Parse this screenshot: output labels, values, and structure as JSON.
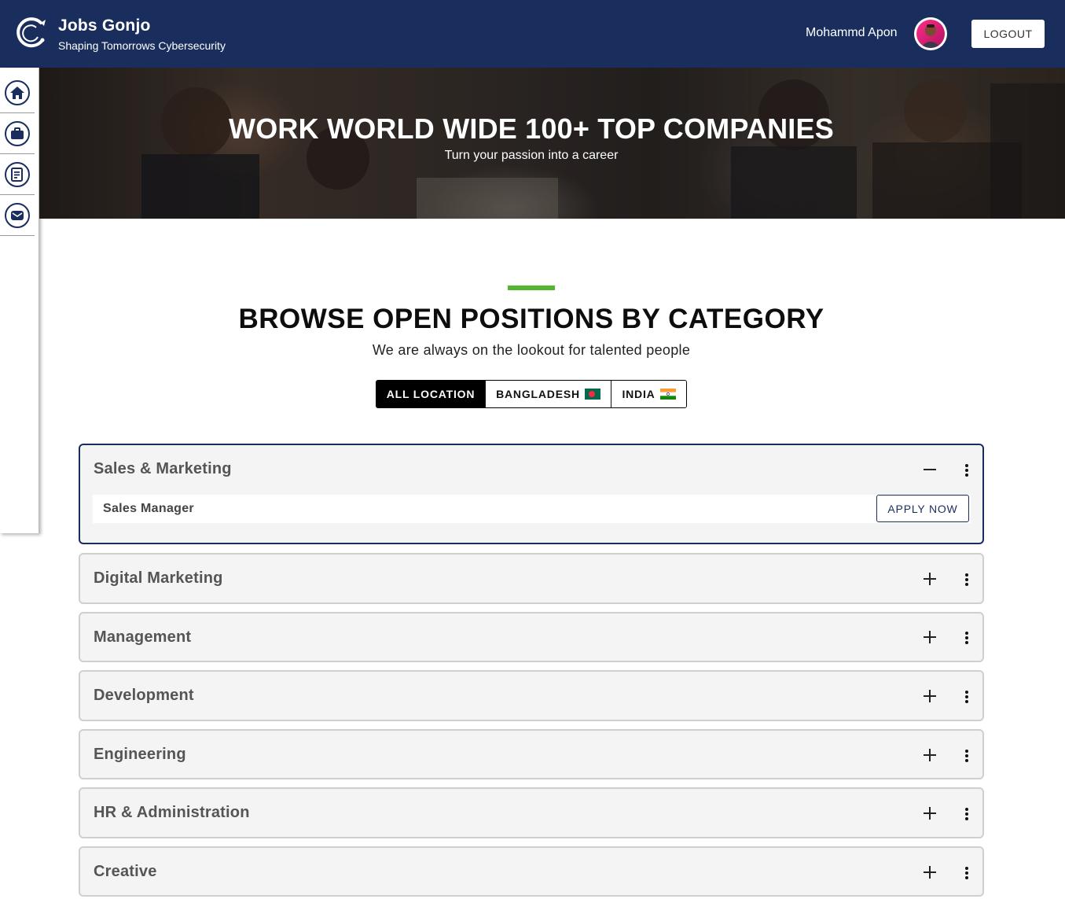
{
  "header": {
    "brand_title": "Jobs Gonjo",
    "brand_subtitle": "Shaping Tomorrows Cybersecurity",
    "user_name": "Mohammd Apon",
    "logout_label": "LOGOUT",
    "logo_icon": "dragon-logo-icon",
    "avatar_icon": "user-avatar"
  },
  "sidebar": {
    "items": [
      {
        "name": "home",
        "icon": "home-icon"
      },
      {
        "name": "jobs",
        "icon": "briefcase-icon"
      },
      {
        "name": "applications",
        "icon": "document-list-icon"
      },
      {
        "name": "messages",
        "icon": "envelope-icon"
      }
    ]
  },
  "hero": {
    "title": "WORK WORLD WIDE 100+ TOP COMPANIES",
    "subtitle": "Turn your passion into a career"
  },
  "section": {
    "title": "BROWSE OPEN POSITIONS BY CATEGORY",
    "subtitle": "We are always on the lookout for talented people"
  },
  "locations": {
    "selected": "ALL LOCATION",
    "options": [
      {
        "label": "ALL LOCATION",
        "flag": ""
      },
      {
        "label": "BANGLADESH",
        "flag": "bangladesh-flag-icon"
      },
      {
        "label": "INDIA",
        "flag": "india-flag-icon"
      }
    ]
  },
  "categories": [
    {
      "title": "Sales & Marketing",
      "expanded": true,
      "jobs": [
        {
          "title": "Sales Manager",
          "action": "APPLY NOW"
        }
      ]
    },
    {
      "title": "Digital Marketing",
      "expanded": false
    },
    {
      "title": "Management",
      "expanded": false
    },
    {
      "title": "Development",
      "expanded": false
    },
    {
      "title": "Engineering",
      "expanded": false
    },
    {
      "title": "HR & Administration",
      "expanded": false
    },
    {
      "title": "Creative",
      "expanded": false
    }
  ],
  "colors": {
    "navy": "#1a2e5e",
    "accent_green": "#52b52f",
    "card_bg": "#f4f4f4"
  }
}
